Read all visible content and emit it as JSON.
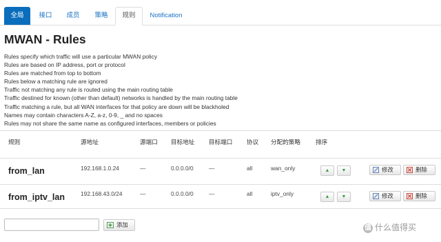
{
  "tabs": [
    {
      "label": "全局",
      "style": "active-blue"
    },
    {
      "label": "接口",
      "style": "plain"
    },
    {
      "label": "成员",
      "style": "plain"
    },
    {
      "label": "策略",
      "style": "plain"
    },
    {
      "label": "规则",
      "style": "selected"
    },
    {
      "label": "Notification",
      "style": "plain"
    }
  ],
  "page_title": "MWAN - Rules",
  "description": [
    "Rules specify which traffic will use a particular MWAN policy",
    "Rules are based on IP address, port or protocol",
    "Rules are matched from top to bottom",
    "Rules below a matching rule are ignored",
    "Traffic not matching any rule is routed using the main routing table",
    "Traffic destined for known (other than default) networks is handled by the main routing table",
    "Traffic matching a rule, but all WAN interfaces for that policy are down will be blackholed",
    "Names may contain characters A-Z, a-z, 0-9, _ and no spaces",
    "Rules may not share the same name as configured interfaces, members or policies"
  ],
  "table": {
    "headers": [
      "规则",
      "源地址",
      "源端口",
      "目标地址",
      "目标端口",
      "协议",
      "分配的策略",
      "排序"
    ],
    "rows": [
      {
        "name": "from_lan",
        "src_ip": "192.168.1.0.24",
        "src_port": "—",
        "dest_ip": "0.0.0.0/0",
        "dest_port": "—",
        "proto": "all",
        "policy": "wan_only"
      },
      {
        "name": "from_iptv_lan",
        "src_ip": "192.168.43.0/24",
        "src_port": "—",
        "dest_ip": "0.0.0.0/0",
        "dest_port": "—",
        "proto": "all",
        "policy": "iptv_only"
      }
    ],
    "up_arrow": "▲",
    "down_arrow": "▼",
    "edit_label": "修改",
    "delete_label": "删除"
  },
  "add": {
    "input_value": "",
    "button_label": "添加"
  },
  "watermark": {
    "badge": "值",
    "text": "什么值得买"
  },
  "colors": {
    "tab_active": "#0a6ebd",
    "link": "#1a73c5",
    "arrow_green": "#3a9a3a",
    "delete_red": "#c0392b"
  }
}
